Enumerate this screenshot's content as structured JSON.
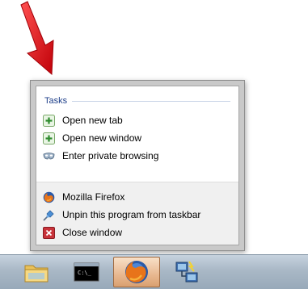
{
  "jumplist": {
    "tasks_header": "Tasks",
    "tasks": [
      {
        "label": "Open new tab",
        "icon": "green-plus-icon"
      },
      {
        "label": "Open new window",
        "icon": "green-plus-icon"
      },
      {
        "label": "Enter private browsing",
        "icon": "mask-icon"
      }
    ],
    "pinned": [
      {
        "label": "Mozilla Firefox",
        "icon": "firefox-icon"
      },
      {
        "label": "Unpin this program from taskbar",
        "icon": "unpin-icon"
      },
      {
        "label": "Close window",
        "icon": "close-window-icon"
      }
    ]
  },
  "taskbar": {
    "buttons": [
      {
        "name": "explorer",
        "icon": "folder-icon",
        "active": false
      },
      {
        "name": "command-prompt",
        "icon": "cmd-icon",
        "active": false,
        "text": "C:\\_"
      },
      {
        "name": "firefox",
        "icon": "firefox-icon",
        "active": true
      },
      {
        "name": "network",
        "icon": "network-icon",
        "active": false
      }
    ]
  },
  "colors": {
    "arrow": "#e8101a",
    "tasks_header": "#1e3f8a",
    "taskbar": "#a9b8c6",
    "active_button": "#e8b890"
  }
}
